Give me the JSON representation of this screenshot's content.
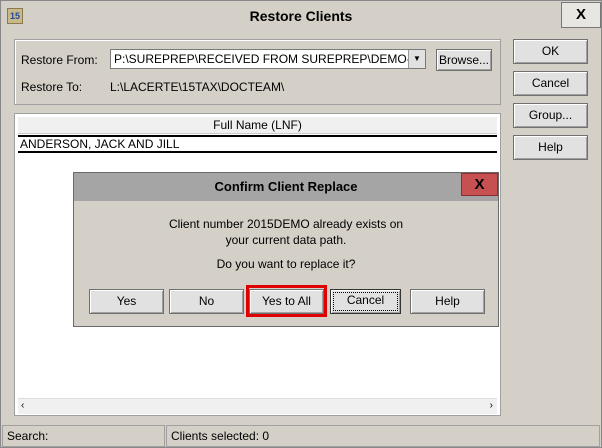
{
  "window": {
    "title": "Restore Clients",
    "icon": "lacerte-15-icon",
    "close": "X"
  },
  "restore_from": {
    "label": "Restore From:",
    "value": "P:\\SUREPREP\\RECEIVED FROM SUREPREP\\DEMO-LAC\\",
    "browse": "Browse..."
  },
  "restore_to": {
    "label": "Restore To:",
    "value": "L:\\LACERTE\\15TAX\\DOCTEAM\\"
  },
  "side_buttons": {
    "ok": "OK",
    "cancel": "Cancel",
    "group": "Group...",
    "help": "Help"
  },
  "list": {
    "header": "Full Name (LNF)",
    "rows": [
      "ANDERSON, JACK AND JILL"
    ]
  },
  "status": {
    "search": "Search:",
    "selected": "Clients selected:  0"
  },
  "dialog": {
    "title": "Confirm Client Replace",
    "close": "X",
    "line1": "Client number 2015DEMO already exists on",
    "line2": "your current data path.",
    "question": "Do you want to replace it?",
    "buttons": {
      "yes": "Yes",
      "no": "No",
      "yes_all": "Yes to All",
      "cancel": "Cancel",
      "help": "Help"
    }
  },
  "colors": {
    "highlight": "#e00000",
    "dialog_close": "#c75050"
  }
}
